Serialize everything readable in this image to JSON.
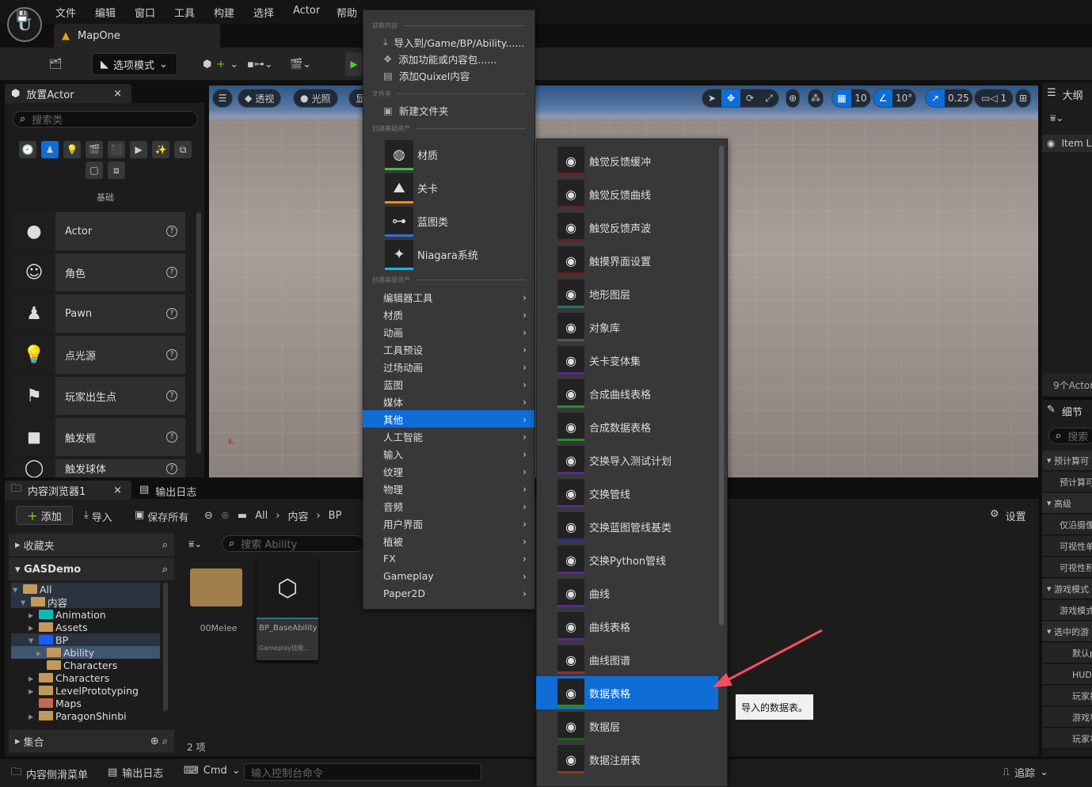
{
  "menubar": {
    "items": [
      "文件",
      "编辑",
      "窗口",
      "工具",
      "构建",
      "选择",
      "Actor",
      "帮助"
    ],
    "logo": "U"
  },
  "level_tab": {
    "label": "MapOne"
  },
  "toolbar": {
    "mode_label": "选项模式"
  },
  "place_actor": {
    "tab_label": "放置Actor",
    "search_placeholder": "搜索类",
    "category_label": "基础",
    "categories": [
      "recent",
      "basic",
      "lights",
      "cinematic",
      "visual-effects",
      "volumes",
      "niagara",
      "shapes",
      "geometry",
      "all-classes"
    ],
    "items": [
      {
        "label": "Actor",
        "icon": "sphere-icon"
      },
      {
        "label": "角色",
        "icon": "character-icon"
      },
      {
        "label": "Pawn",
        "icon": "pawn-icon"
      },
      {
        "label": "点光源",
        "icon": "light-bulb-icon"
      },
      {
        "label": "玩家出生点",
        "icon": "player-start-icon"
      },
      {
        "label": "触发框",
        "icon": "trigger-box-icon"
      },
      {
        "label": "触发球体",
        "icon": "trigger-sphere-icon"
      }
    ]
  },
  "viewport": {
    "menu": "☰",
    "perspective": "透视",
    "lighting": "光照",
    "show": "显",
    "grid_snap": "10",
    "rotation_snap": "10°",
    "scale_snap": "0.25",
    "camera_speed": "1",
    "accent": "#0e6dd6"
  },
  "context_menu": {
    "sec_get": "获取内容",
    "import": "导入到/Game/BP/Ability......",
    "add_feature": "添加功能或内容包......",
    "add_quixel": "添加Quixel内容",
    "sec_folder": "文件夹",
    "new_folder": "新建文件夹",
    "sec_basic": "创建基础资产",
    "basic": [
      {
        "label": "材质",
        "color": "#3fbf3f"
      },
      {
        "label": "关卡",
        "color": "#ff8c00"
      },
      {
        "label": "蓝图类",
        "color": "#2f6fe0"
      },
      {
        "label": "Niagara系统",
        "color": "#00bfff"
      }
    ],
    "sec_advanced": "创建高级资产",
    "advanced": [
      "编辑器工具",
      "材质",
      "动画",
      "工具预设",
      "过场动画",
      "蓝图",
      "媒体",
      "其他",
      "人工智能",
      "输入",
      "纹理",
      "物理",
      "音频",
      "用户界面",
      "植被",
      "FX",
      "Gameplay",
      "Paper2D"
    ],
    "selected": "其他"
  },
  "submenu": {
    "items": [
      {
        "label": "触觉反馈缓冲",
        "color": "#6b1f1f"
      },
      {
        "label": "触觉反馈曲线",
        "color": "#6b1f1f"
      },
      {
        "label": "触觉反馈声波",
        "color": "#6b1f1f"
      },
      {
        "label": "触摸界面设置",
        "color": "#6b1f1f"
      },
      {
        "label": "地形图层",
        "color": "#2a6f6f"
      },
      {
        "label": "对象库",
        "color": "#555555"
      },
      {
        "label": "关卡变体集",
        "color": "#5a2a8a"
      },
      {
        "label": "合成曲线表格",
        "color": "#2a8a2a"
      },
      {
        "label": "合成数据表格",
        "color": "#2a8a2a"
      },
      {
        "label": "交换导入测试计划",
        "color": "#5a2a8a"
      },
      {
        "label": "交换管线",
        "color": "#5a2a8a"
      },
      {
        "label": "交换蓝图管线基类",
        "color": "#2a2a8a"
      },
      {
        "label": "交换Python管线",
        "color": "#5a2a8a"
      },
      {
        "label": "曲线",
        "color": "#5a2a8a"
      },
      {
        "label": "曲线表格",
        "color": "#5a2a8a"
      },
      {
        "label": "曲线图谱",
        "color": "#8a3030"
      },
      {
        "label": "数据表格",
        "color": "#2a8a2a"
      },
      {
        "label": "数据层",
        "color": "#1f5f1f"
      },
      {
        "label": "数据注册表",
        "color": "#8a3a20"
      }
    ],
    "selected": "数据表格"
  },
  "tooltip": "导入的数据表。",
  "outliner": {
    "title": "大纲",
    "column": "Item L",
    "count": "9个Actor"
  },
  "details": {
    "title": "细节",
    "search": "搜索",
    "rows": [
      "预计算可",
      "预计算可",
      "高级",
      "仅沿摄像",
      "可视性单",
      "可视性积",
      "游戏模式",
      "游戏模式",
      "选中的游",
      "默认p",
      "HUD类",
      "玩家控",
      "游戏状",
      "玩家状"
    ]
  },
  "content_browser": {
    "tab_label": "内容浏览器1",
    "log_tab": "输出日志",
    "add": "添加",
    "import": "导入",
    "save_all": "保存所有",
    "breadcrumb": [
      "All",
      "内容",
      "BP"
    ],
    "settings": "设置",
    "favorites": "收藏夹",
    "project": "GASDemo",
    "search_placeholder": "搜索 Ability",
    "collections": "集合",
    "tree": [
      {
        "label": "All",
        "depth": 0,
        "open": true
      },
      {
        "label": "内容",
        "depth": 1,
        "open": true
      },
      {
        "label": "Animation",
        "depth": 2,
        "color": "#10b8b8"
      },
      {
        "label": "Assets",
        "depth": 2
      },
      {
        "label": "BP",
        "depth": 2,
        "open": true,
        "color": "#1a5cff"
      },
      {
        "label": "Ability",
        "depth": 3,
        "selected": true
      },
      {
        "label": "Characters",
        "depth": 3
      },
      {
        "label": "Characters",
        "depth": 2
      },
      {
        "label": "LevelPrototyping",
        "depth": 2
      },
      {
        "label": "Maps",
        "depth": 2,
        "color": "#c06a50"
      },
      {
        "label": "ParagonShinbi",
        "depth": 2
      }
    ],
    "assets": [
      {
        "label": "00Melee",
        "type": "folder"
      },
      {
        "label": "BP_BaseAbility",
        "subtitle": "Gameplay技能..."
      }
    ],
    "item_count": "2 项"
  },
  "statusbar": {
    "drawer": "内容侧滑菜单",
    "log": "输出日志",
    "cmd": "Cmd",
    "console_placeholder": "输入控制台命令",
    "trace": "追踪"
  }
}
